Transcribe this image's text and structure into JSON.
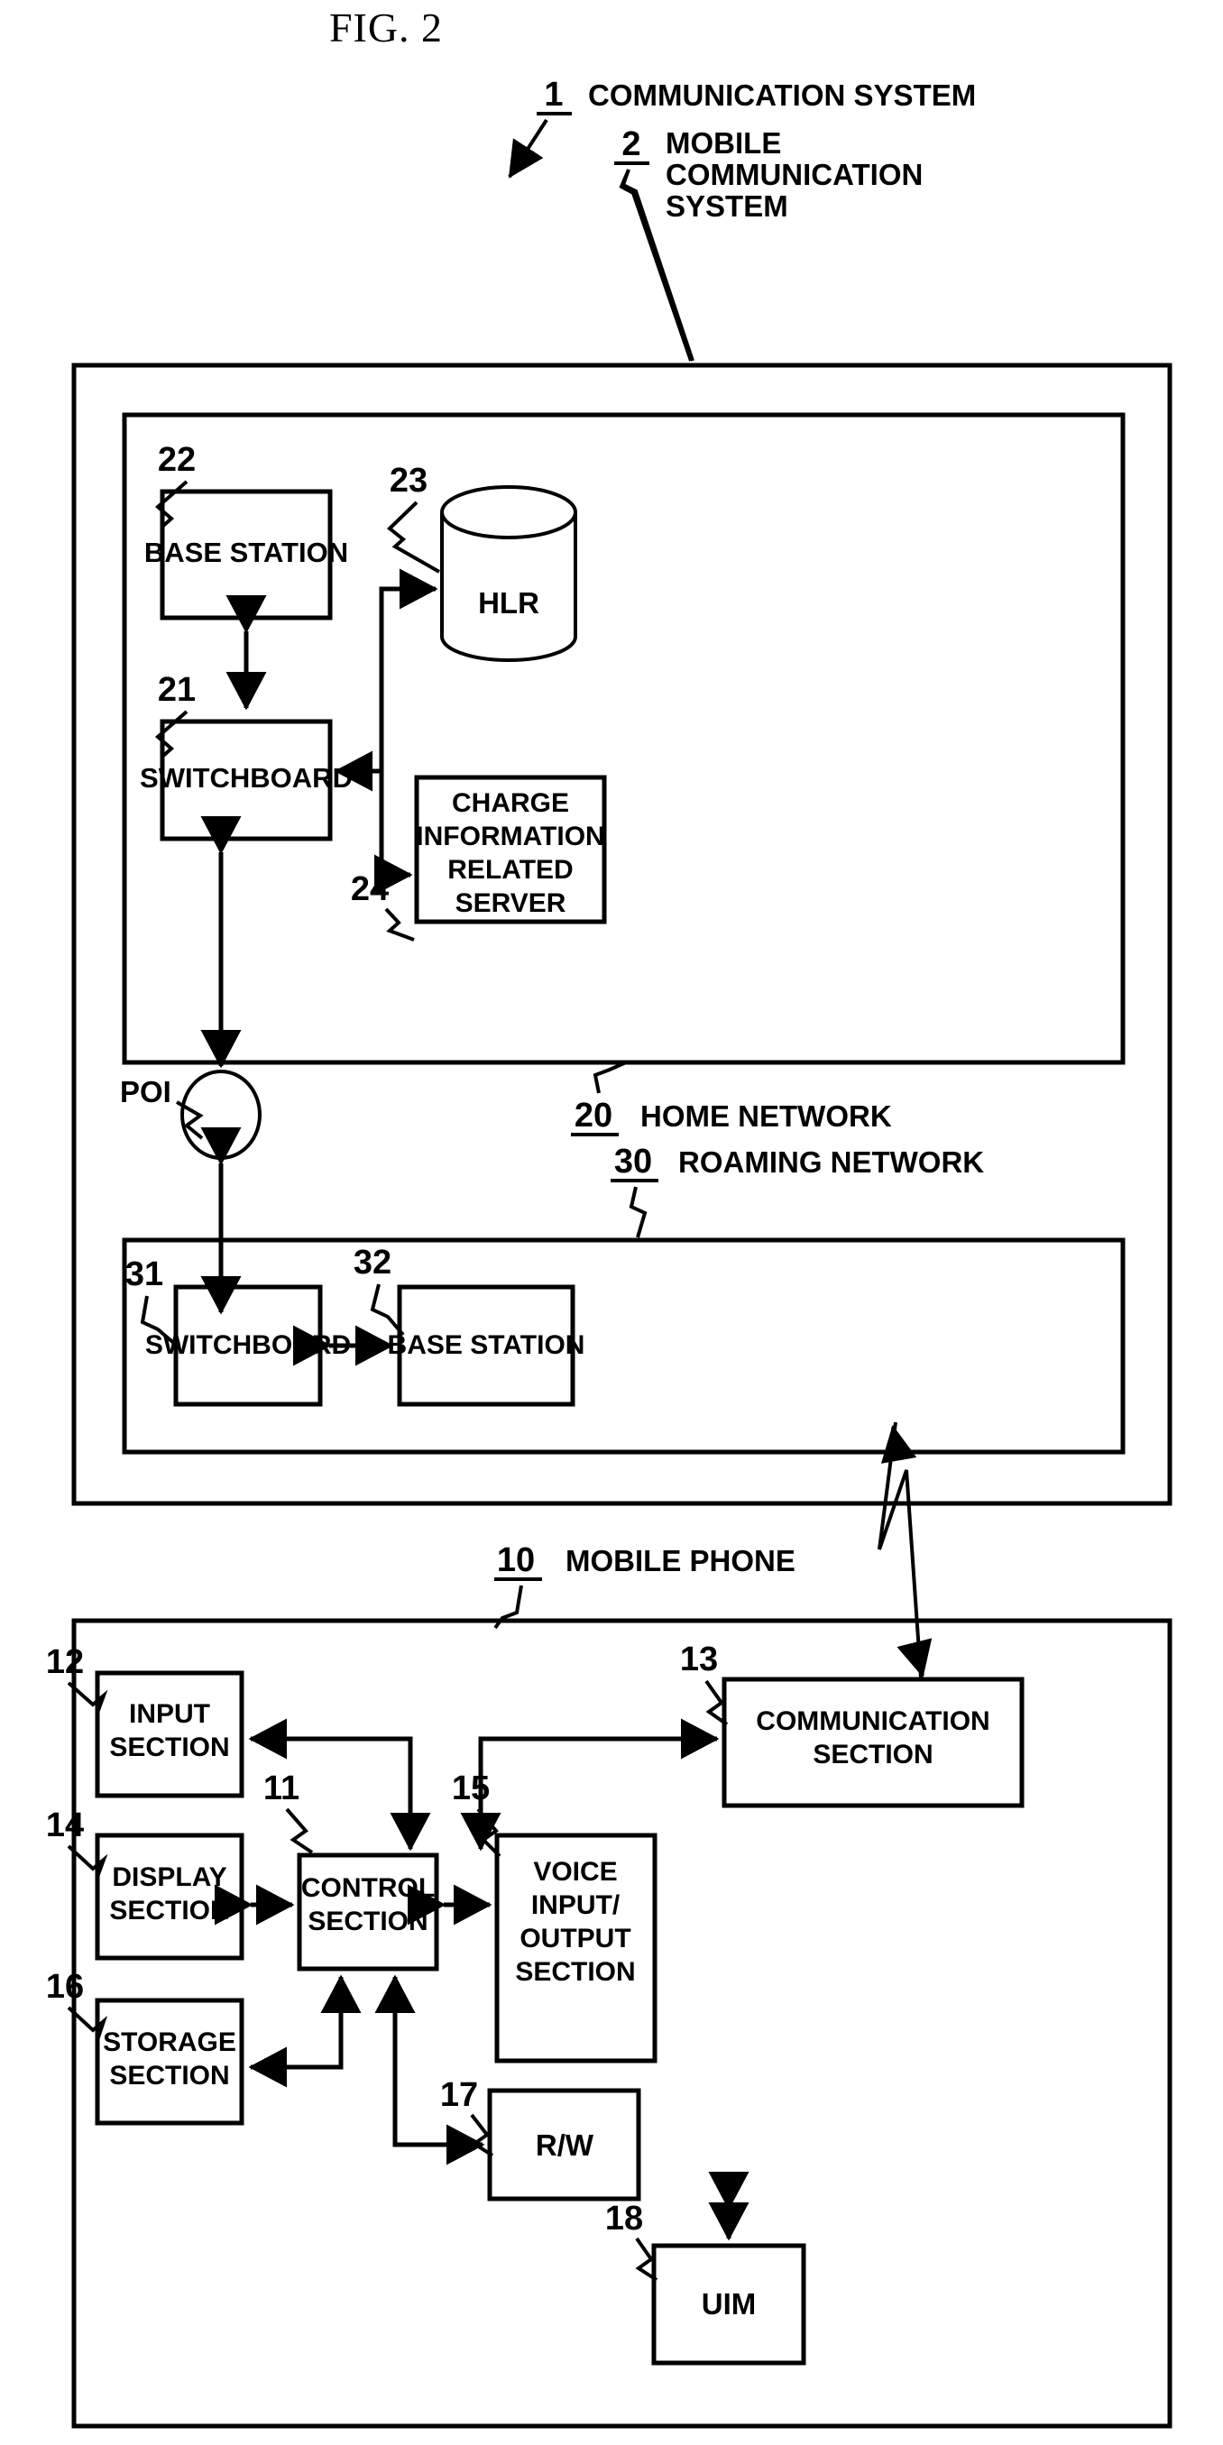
{
  "figure": {
    "title": "FIG. 2",
    "domain_kind": "patent-block-diagram"
  },
  "top_labels": [
    {
      "ref": "1",
      "text": "COMMUNICATION SYSTEM"
    },
    {
      "ref": "2",
      "text_line1": "MOBILE",
      "text_line2": "COMMUNICATION",
      "text_line3": "SYSTEM"
    }
  ],
  "network_labels": [
    {
      "ref": "20",
      "text": "HOME NETWORK"
    },
    {
      "ref": "30",
      "text": "ROAMING NETWORK"
    },
    {
      "ref": "10",
      "text": "MOBILE PHONE"
    }
  ],
  "home_network": {
    "blocks": [
      {
        "ref": "22",
        "label": "BASE STATION"
      },
      {
        "ref": "21",
        "label": "SWITCHBOARD"
      },
      {
        "ref": "23",
        "label": "HLR",
        "shape": "cylinder"
      },
      {
        "ref": "24",
        "label_line1": "CHARGE",
        "label_line2": "INFORMATION",
        "label_line3": "RELATED",
        "label_line4": "SERVER"
      }
    ]
  },
  "poi": {
    "label": "POI",
    "shape": "circle"
  },
  "roaming_network": {
    "blocks": [
      {
        "ref": "31",
        "label": "SWITCHBOARD"
      },
      {
        "ref": "32",
        "label": "BASE STATION"
      }
    ]
  },
  "mobile_phone": {
    "blocks": [
      {
        "ref": "12",
        "label_line1": "INPUT",
        "label_line2": "SECTION"
      },
      {
        "ref": "13",
        "label_line1": "COMMUNICATION",
        "label_line2": "SECTION"
      },
      {
        "ref": "14",
        "label_line1": "DISPLAY",
        "label_line2": "SECTION"
      },
      {
        "ref": "11",
        "label_line1": "CONTROL",
        "label_line2": "SECTION"
      },
      {
        "ref": "15",
        "label_line1": "VOICE",
        "label_line2": "INPUT/",
        "label_line3": "OUTPUT",
        "label_line4": "SECTION"
      },
      {
        "ref": "16",
        "label_line1": "STORAGE",
        "label_line2": "SECTION"
      },
      {
        "ref": "17",
        "label": "R/W"
      },
      {
        "ref": "18",
        "label": "UIM"
      }
    ]
  },
  "colors": {
    "ink": "#000000",
    "paper": "#ffffff"
  }
}
